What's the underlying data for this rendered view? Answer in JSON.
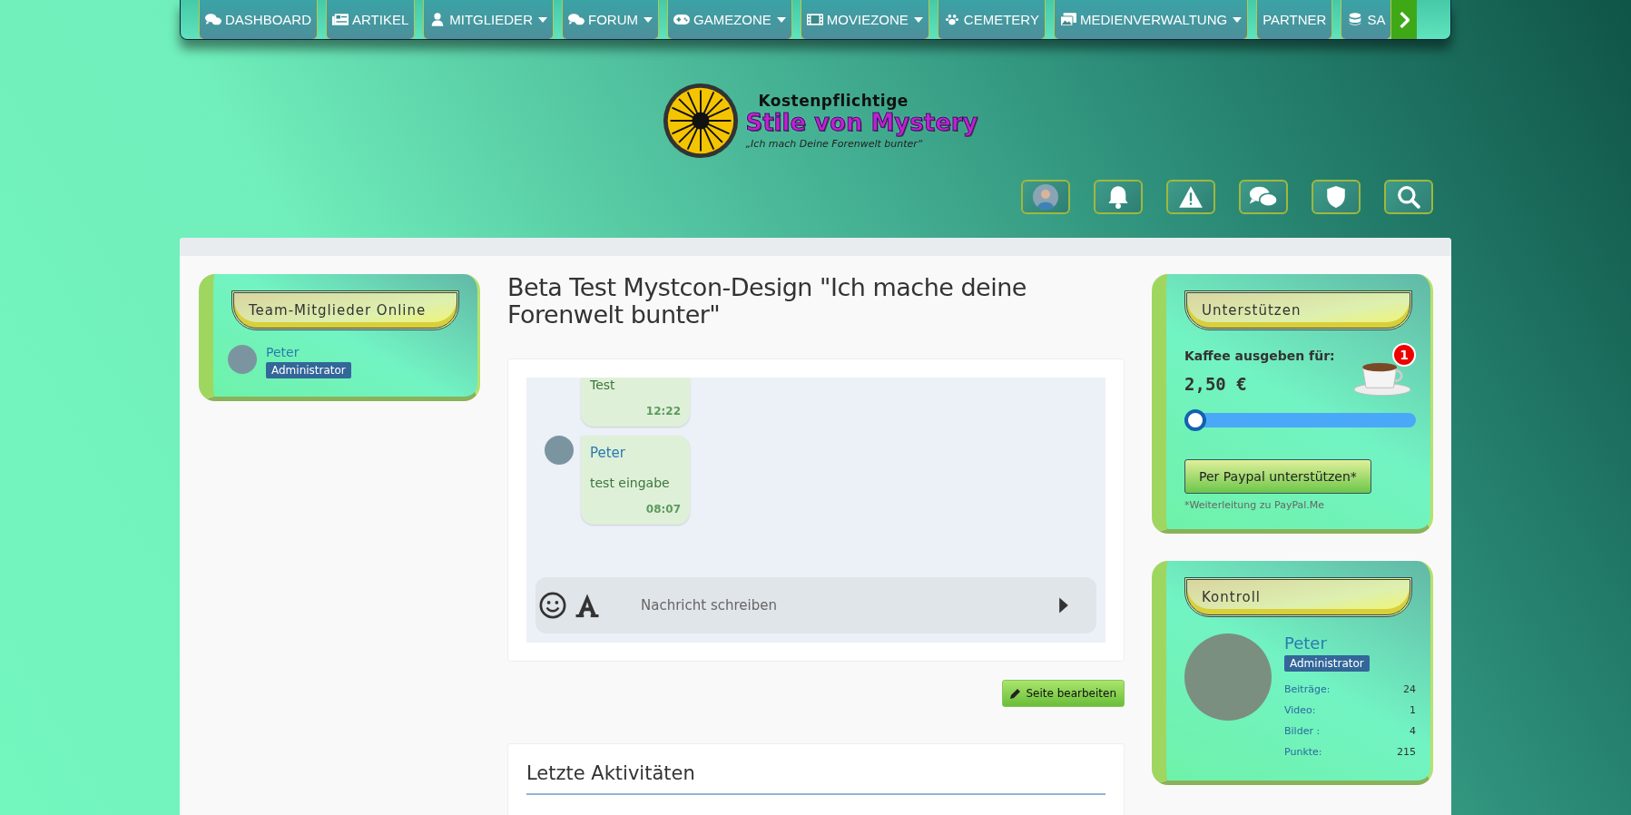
{
  "nav": {
    "items": [
      {
        "label": "DASHBOARD",
        "dropdown": false
      },
      {
        "label": "ARTIKEL",
        "dropdown": false
      },
      {
        "label": "MITGLIEDER",
        "dropdown": true
      },
      {
        "label": "FORUM",
        "dropdown": true
      },
      {
        "label": "GAMEZONE",
        "dropdown": true
      },
      {
        "label": "MOVIEZONE",
        "dropdown": true
      },
      {
        "label": "CEMETERY",
        "dropdown": false
      },
      {
        "label": "MEDIENVERWALTUNG",
        "dropdown": true
      },
      {
        "label": "PARTNER",
        "dropdown": false
      },
      {
        "label": "SA",
        "dropdown": false
      }
    ]
  },
  "logo": {
    "overline": "Kostenpflichtige",
    "name": "Stile von Mystery",
    "tagline": "„Ich mach Deine Forenwelt bunter“"
  },
  "team_online": {
    "title": "Team-Mitglieder Online",
    "members": [
      {
        "name": "Peter",
        "role": "Administrator"
      }
    ]
  },
  "page_title": "Beta Test Mystcon-Design \"Ich mache deine Forenwelt bunter\"",
  "chat": {
    "messages": [
      {
        "text": "Test",
        "time": "12:22"
      },
      {
        "author": "Peter",
        "text": "test eingabe",
        "time": "08:07"
      }
    ],
    "input": {
      "placeholder": "Nachricht schreiben"
    }
  },
  "edit_button": "Seite bearbeiten",
  "activities": {
    "title": "Letzte Aktivitäten"
  },
  "support": {
    "title": "Unterstützen",
    "label": "Kaffee ausgeben für:",
    "amount": "2,50 €",
    "badge": "1",
    "slider": {
      "level": 0
    },
    "button": "Per Paypal unterstützen*",
    "note": "*Weiterleitung zu PayPal.Me"
  },
  "control": {
    "title": "Kontroll",
    "name": "Peter",
    "role": "Administrator",
    "stats": [
      {
        "label": "Beiträge:",
        "value": "24"
      },
      {
        "label": "Video:",
        "value": "1"
      },
      {
        "label": "Bilder :",
        "value": "4"
      },
      {
        "label": "Punkte:",
        "value": "215"
      }
    ]
  }
}
